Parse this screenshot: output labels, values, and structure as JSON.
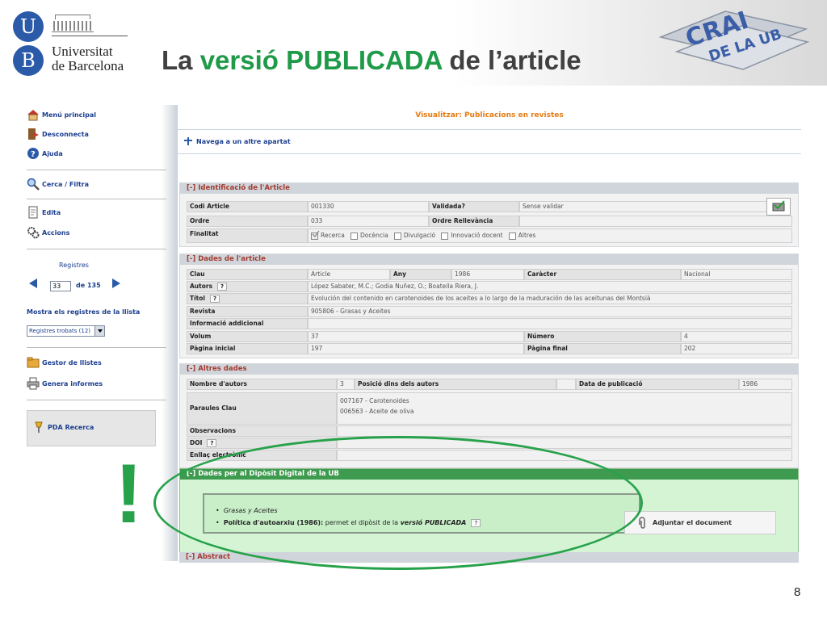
{
  "header": {
    "university_line1": "Universitat",
    "university_line2": "de Barcelona",
    "ub_letter_u": "U",
    "ub_letter_b": "B",
    "title_part1": "La ",
    "title_part2": "versió PUBLICADA",
    "title_part3": " de l’article",
    "crai_text": "CRAI",
    "crai_sub": "DE LA UB"
  },
  "sidebar": {
    "menu_principal": "Menú principal",
    "desconnecta": "Desconnecta",
    "ajuda": "Ajuda",
    "cerca": "Cerca / Filtra",
    "edita": "Edita",
    "accions": "Accions",
    "registres_label": "Registres",
    "registre_actual": "33",
    "registres_total": "de 135",
    "mostra_label": "Mostra els registres de la llista",
    "select_value": "Registres trobats (12)",
    "gestor": "Gestor de llistes",
    "informes": "Genera informes",
    "pda": "PDA Recerca"
  },
  "content": {
    "title": "Visualitzar: Publicacions en revistes",
    "navega": "Navega a un altre apartat",
    "sec1": {
      "head": "[-]  Identificació de l'Article",
      "codi_lbl": "Codi Article",
      "codi_val": "001330",
      "validada_lbl": "Validada?",
      "validada_val": "Sense validar",
      "ordre_lbl": "Ordre",
      "ordre_val": "033",
      "rellevancia_lbl": "Ordre Rellevància",
      "finalitat_lbl": "Finalitat",
      "finalitats": [
        "Recerca",
        "Docència",
        "Divulgació",
        "Innovació docent",
        "Altres"
      ]
    },
    "sec2": {
      "head": "[-]  Dades de l'article",
      "clau_lbl": "Clau",
      "clau_val": "Article",
      "any_lbl": "Any",
      "any_val": "1986",
      "caracter_lbl": "Caràcter",
      "caracter_val": "Nacional",
      "autors_lbl": "Autors",
      "autors_val": "López Sabater, M.C.; Godia Nuñez, O.; Boatella Riera, J.",
      "titol_lbl": "Títol",
      "titol_val": "Evolución del contenido en carotenoides de los aceites a lo largo de la maduración de las aceitunas del Montsià",
      "revista_lbl": "Revista",
      "revista_val": "905806 - Grasas y Aceites",
      "info_lbl": "Informació addicional",
      "volum_lbl": "Volum",
      "volum_val": "37",
      "numero_lbl": "Número",
      "numero_val": "4",
      "pagini_lbl": "Pàgina inicial",
      "pagini_val": "197",
      "pagfin_lbl": "Pàgina final",
      "pagfin_val": "202"
    },
    "sec3": {
      "head": "[-]  Altres dades",
      "nautors_lbl": "Nombre d'autors",
      "nautors_val": "3",
      "posicio_lbl": "Posició dins dels autors",
      "data_lbl": "Data de publicació",
      "data_val": "1986",
      "paraules_lbl": "Paraules Clau",
      "paraula1": "007167 - Carotenoides",
      "paraula2": "006563 - Aceite de oliva",
      "observ_lbl": "Observacions",
      "doi_lbl": "DOI",
      "enllac_lbl": "Enllaç electrònic"
    },
    "sec4": {
      "head": "[-]  Dades per al Dipòsit Digital de la UB",
      "item1": "Grasas y Aceites",
      "item2_a": "Política d'autoarxiu (1986):",
      "item2_b": " permet el dipòsit de la ",
      "item2_c": "versió PUBLICADA",
      "adjuntar": "Adjuntar el document"
    },
    "abstract_head": "[-]  Abstract",
    "q": "?"
  },
  "annotation": {
    "exclamation": "!"
  },
  "page_number": "8",
  "colors": {
    "accent_green": "#27a24a",
    "section_red": "#a33b2f",
    "link_blue": "#1b3e8f",
    "title_orange": "#e67a10"
  }
}
